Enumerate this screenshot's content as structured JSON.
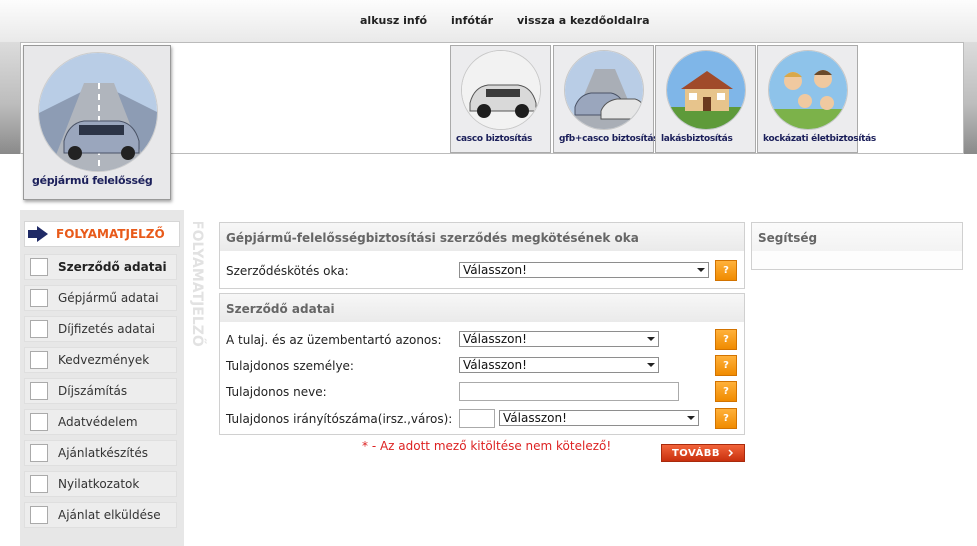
{
  "top_nav": [
    "alkusz infó",
    "infótár",
    "vissza a kezdőoldalra"
  ],
  "banner": {
    "main_tile_label": "gépjármű felelősség",
    "tiles": [
      "casco biztosítás",
      "gfb+casco biztosítás",
      "lakásbiztosítás",
      "kockázati életbiztosítás"
    ]
  },
  "sidebar": {
    "heading": "FOLYAMATJELZŐ",
    "vertical_label": "FOLYAMATJELZŐ",
    "steps": [
      "Szerződő adatai",
      "Gépjármű adatai",
      "Díjfizetés adatai",
      "Kedvezmények",
      "Díjszámítás",
      "Adatvédelem",
      "Ajánlatkészítés",
      "Nyilatkozatok",
      "Ajánlat elküldése"
    ]
  },
  "panel_reason": {
    "title": "Gépjármű-felelősségbiztosítási szerződés megkötésének oka",
    "field_label": "Szerződéskötés oka:",
    "field_value": "Válasszon!"
  },
  "panel_contract": {
    "title": "Szerződő adatai",
    "field1_label": "A tulaj. és az üzembentartó azonos:",
    "field1_value": "Válasszon!",
    "field2_label": "Tulajdonos személye:",
    "field2_value": "Válasszon!",
    "field3_label": "Tulajdonos neve:",
    "field3_value": "",
    "field4_label": "Tulajdonos irányítószáma(irsz.,város):",
    "field4_zip": "",
    "field4_city": "Válasszon!"
  },
  "help_panel": {
    "title": "Segítség"
  },
  "help_icon": "?",
  "note": "* - Az adott mező kitöltése nem kötelező!",
  "next_button": "TOVÁBB",
  "colors": {
    "accent": "#e85a1a",
    "help_button": "#f59a16",
    "next_button": "#d9401a",
    "note": "#dd2222"
  }
}
